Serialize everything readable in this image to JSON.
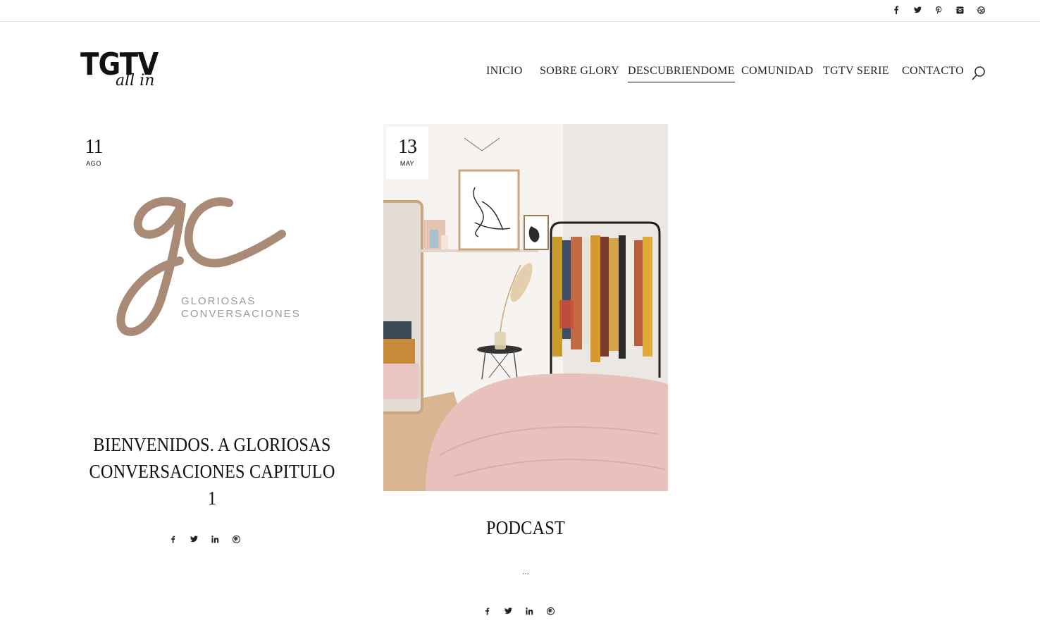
{
  "social_top": [
    {
      "icon": "facebook-icon",
      "glyph": "f"
    },
    {
      "icon": "twitter-icon",
      "glyph": "🐦"
    },
    {
      "icon": "pinterest-icon",
      "glyph": "𝒑"
    },
    {
      "icon": "instagram-icon",
      "glyph": "◘"
    },
    {
      "icon": "dribbble-icon",
      "glyph": "◍"
    }
  ],
  "logo": {
    "main": "TGTV",
    "sub": "all in"
  },
  "nav": {
    "items": [
      "INICIO",
      "SOBRE GLORY",
      "DESCUBRIENDOME",
      "COMUNIDAD",
      "TGTV SERIE",
      "CONTACTO"
    ],
    "active": "DESCUBRIENDOME"
  },
  "posts": [
    {
      "day": "11",
      "month": "AGO",
      "image_text": [
        "GLORIOSAS",
        "CONVERSACIONES"
      ],
      "title_line1": "BIENVENIDOS. A GLORIOSAS",
      "title_line2": "CONVERSACIONES CAPITULO 1"
    },
    {
      "day": "13",
      "month": "MAY",
      "title": "PODCAST",
      "excerpt": "..."
    }
  ],
  "share_icons": [
    "facebook-icon",
    "twitter-icon",
    "linkedin-icon",
    "pinterest-icon"
  ],
  "colors": {
    "gc_brand": "#a88a76",
    "text": "#111111"
  }
}
